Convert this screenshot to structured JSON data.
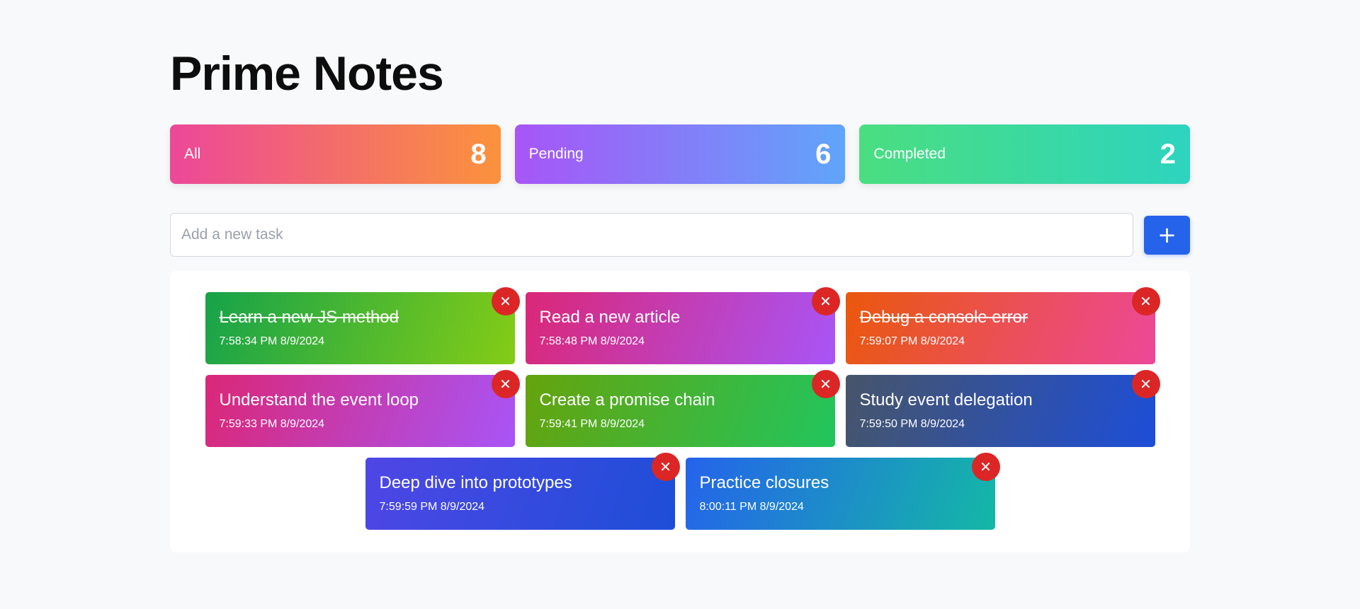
{
  "app": {
    "title": "Prime Notes"
  },
  "stats": [
    {
      "label": "All",
      "count": 8,
      "style": "all"
    },
    {
      "label": "Pending",
      "count": 6,
      "style": "pending"
    },
    {
      "label": "Completed",
      "count": 2,
      "style": "completed"
    }
  ],
  "input": {
    "placeholder": "Add a new task",
    "value": ""
  },
  "add_button": {
    "label": "+"
  },
  "tasks": [
    {
      "title": "Learn a new JS method",
      "time": "7:58:34 PM 8/9/2024",
      "done": true,
      "colors": [
        "#16a34a",
        "#84cc16"
      ]
    },
    {
      "title": "Read a new article",
      "time": "7:58:48 PM 8/9/2024",
      "done": false,
      "colors": [
        "#db2777",
        "#a855f7"
      ]
    },
    {
      "title": "Debug a console error",
      "time": "7:59:07 PM 8/9/2024",
      "done": true,
      "colors": [
        "#ea580c",
        "#ec4899"
      ]
    },
    {
      "title": "Understand the event loop",
      "time": "7:59:33 PM 8/9/2024",
      "done": false,
      "colors": [
        "#db2777",
        "#a855f7"
      ]
    },
    {
      "title": "Create a promise chain",
      "time": "7:59:41 PM 8/9/2024",
      "done": false,
      "colors": [
        "#65a30d",
        "#22c55e"
      ]
    },
    {
      "title": "Study event delegation",
      "time": "7:59:50 PM 8/9/2024",
      "done": false,
      "colors": [
        "#475569",
        "#1d4ed8"
      ]
    },
    {
      "title": "Deep dive into prototypes",
      "time": "7:59:59 PM 8/9/2024",
      "done": false,
      "colors": [
        "#4f46e5",
        "#1d4ed8"
      ]
    },
    {
      "title": "Practice closures",
      "time": "8:00:11 PM 8/9/2024",
      "done": false,
      "colors": [
        "#2563eb",
        "#14b8a6"
      ]
    }
  ],
  "delete_icon": "close-icon",
  "delete_glyph": "✕"
}
